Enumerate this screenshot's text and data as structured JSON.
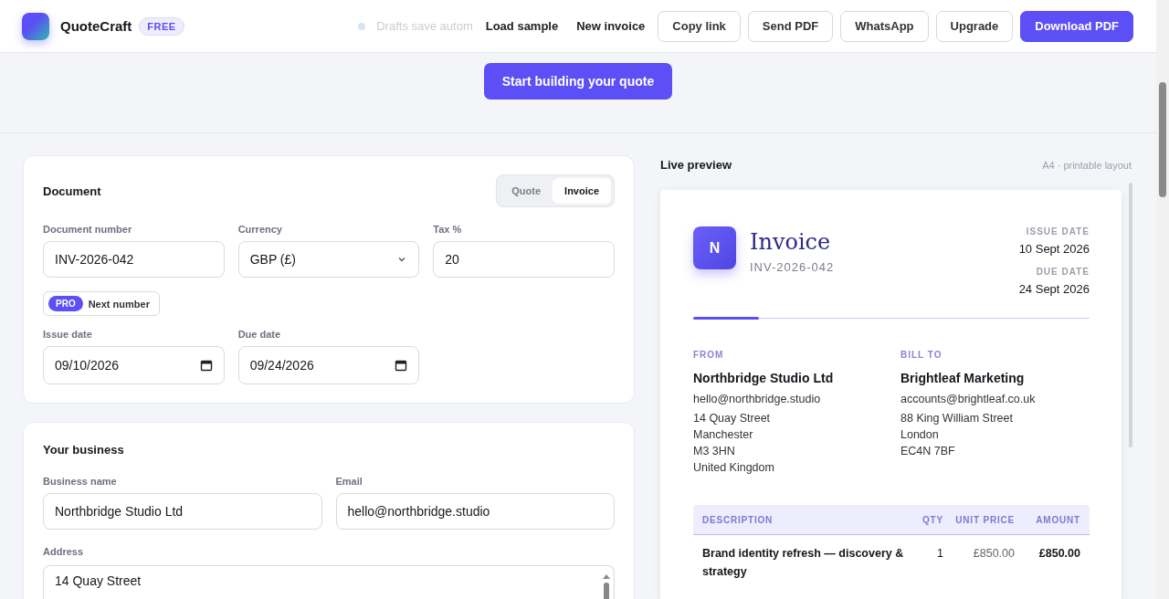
{
  "header": {
    "brand": "QuoteCraft",
    "plan_badge": "FREE",
    "notice": "Drafts save autom",
    "actions": [
      {
        "label": "Load sample",
        "kind": "ghost"
      },
      {
        "label": "New invoice",
        "kind": "ghost"
      },
      {
        "label": "Copy link",
        "kind": "outline"
      },
      {
        "label": "Send PDF",
        "kind": "outline"
      },
      {
        "label": "WhatsApp",
        "kind": "outline"
      },
      {
        "label": "Upgrade",
        "kind": "outline"
      },
      {
        "label": "Download PDF",
        "kind": "primary"
      }
    ]
  },
  "hero": {
    "cta": "Start building your quote"
  },
  "document_card": {
    "title": "Document",
    "doc_types": [
      {
        "label": "Quote",
        "selected": false
      },
      {
        "label": "Invoice",
        "selected": true
      }
    ],
    "fields": [
      {
        "label": "Document number",
        "value": "INV-2026-042",
        "kind": "text"
      },
      {
        "label": "Currency",
        "value": "GBP (£)",
        "kind": "select"
      },
      {
        "label": "Tax %",
        "value": "20",
        "kind": "text"
      }
    ],
    "next_number": {
      "badge": "PRO",
      "label": "Next number"
    },
    "dates": [
      {
        "label": "Issue date",
        "value": "09/10/2026",
        "kind": "date"
      },
      {
        "label": "Due date",
        "value": "09/24/2026",
        "kind": "date"
      }
    ]
  },
  "business_card": {
    "title": "Your business",
    "fields": [
      {
        "label": "Business name",
        "value": "Northbridge Studio Ltd"
      },
      {
        "label": "Email",
        "value": "hello@northbridge.studio"
      }
    ],
    "address_label": "Address",
    "address_value": "14 Quay Street"
  },
  "preview": {
    "title": "Live preview",
    "hint": "A4 · printable layout",
    "logo_letter": "N",
    "doc_title": "Invoice",
    "doc_number": "INV-2026-042",
    "meta": [
      {
        "label": "ISSUE DATE",
        "value": "10 Sept 2026"
      },
      {
        "label": "DUE DATE",
        "value": "24 Sept 2026"
      }
    ],
    "parties": [
      {
        "label": "FROM",
        "name": "Northbridge Studio Ltd",
        "email": "hello@northbridge.studio",
        "address": [
          "14 Quay Street",
          "Manchester",
          "M3 3HN",
          "United Kingdom"
        ]
      },
      {
        "label": "BILL TO",
        "name": "Brightleaf Marketing",
        "email": "accounts@brightleaf.co.uk",
        "address": [
          "88 King William Street",
          "London",
          "EC4N 7BF"
        ]
      }
    ],
    "table": {
      "columns": [
        "DESCRIPTION",
        "QTY",
        "UNIT PRICE",
        "AMOUNT"
      ],
      "rows": [
        [
          "Brand identity refresh — discovery & strategy",
          "1",
          "£850.00",
          "£850.00"
        ]
      ]
    }
  }
}
